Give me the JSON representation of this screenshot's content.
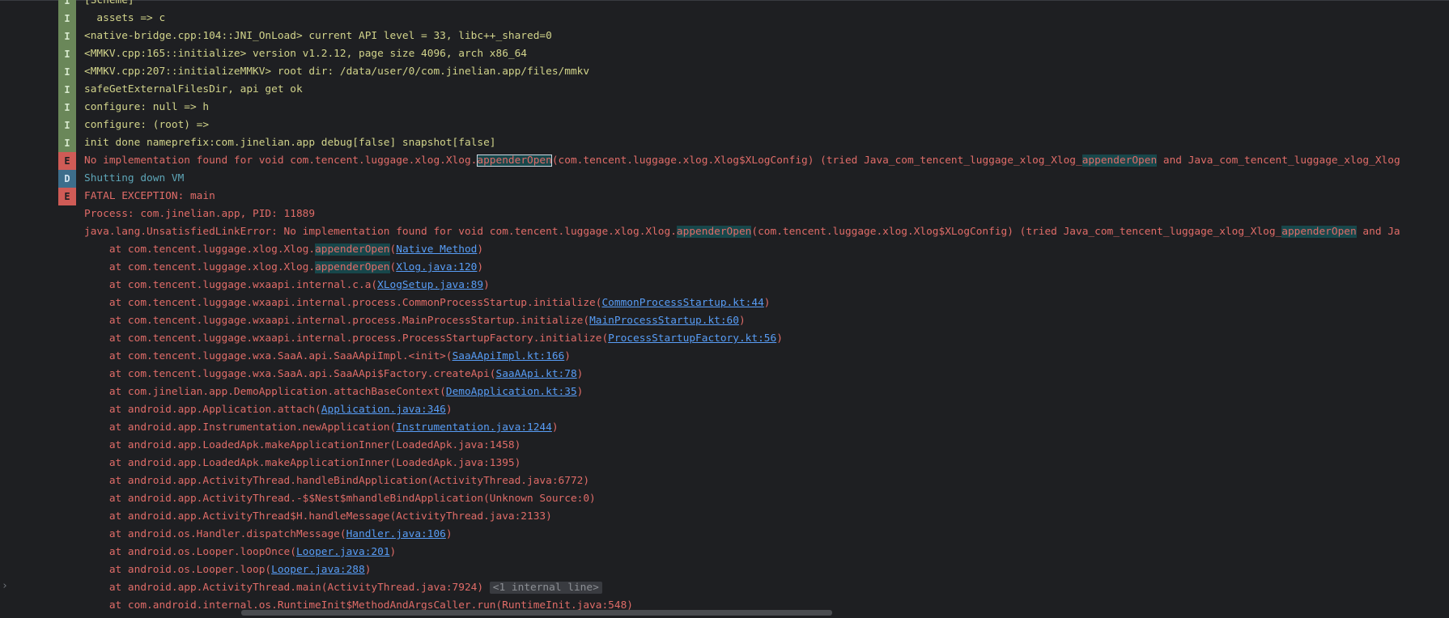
{
  "log": [
    {
      "level": "I",
      "segments": [
        {
          "t": "[Scheme]"
        }
      ]
    },
    {
      "level": "I",
      "segments": [
        {
          "t": "  assets => c"
        }
      ]
    },
    {
      "level": "I",
      "segments": [
        {
          "t": "<native-bridge.cpp:104::JNI_OnLoad> current API level = 33, libc++_shared=0"
        }
      ]
    },
    {
      "level": "I",
      "segments": [
        {
          "t": "<MMKV.cpp:165::initialize> version v1.2.12, page size 4096, arch x86_64"
        }
      ]
    },
    {
      "level": "I",
      "segments": [
        {
          "t": "<MMKV.cpp:207::initializeMMKV> root dir: /data/user/0/com.jinelian.app/files/mmkv"
        }
      ]
    },
    {
      "level": "I",
      "segments": [
        {
          "t": "safeGetExternalFilesDir, api get ok"
        }
      ]
    },
    {
      "level": "I",
      "segments": [
        {
          "t": "configure: null => h"
        }
      ]
    },
    {
      "level": "I",
      "segments": [
        {
          "t": "configure: (root) =>"
        }
      ]
    },
    {
      "level": "I",
      "segments": [
        {
          "t": "init done nameprefix:com.jinelian.app debug[false] snapshot[false]"
        }
      ]
    },
    {
      "level": "E",
      "segments": [
        {
          "t": "No implementation found for void com.tencent.luggage.xlog.Xlog."
        },
        {
          "t": "appenderOpen",
          "hl": "sel"
        },
        {
          "t": "(com.tencent.luggage.xlog.Xlog$XLogConfig) (tried Java_com_tencent_luggage_xlog_Xlog_"
        },
        {
          "t": "appenderOpen",
          "hl": "match"
        },
        {
          "t": " and Java_com_tencent_luggage_xlog_Xlog"
        }
      ]
    },
    {
      "level": "D",
      "segments": [
        {
          "t": "Shutting down VM"
        }
      ]
    },
    {
      "level": "E",
      "segments": [
        {
          "t": "FATAL EXCEPTION: main"
        }
      ]
    },
    {
      "level": "T",
      "segments": [
        {
          "t": "Process: com.jinelian.app, PID: 11889"
        }
      ]
    },
    {
      "level": "T",
      "segments": [
        {
          "t": "java.lang.UnsatisfiedLinkError: No implementation found for void com.tencent.luggage.xlog.Xlog."
        },
        {
          "t": "appenderOpen",
          "hl": "match"
        },
        {
          "t": "(com.tencent.luggage.xlog.Xlog$XLogConfig) (tried Java_com_tencent_luggage_xlog_Xlog_"
        },
        {
          "t": "appenderOpen",
          "hl": "match"
        },
        {
          "t": " and Ja"
        }
      ]
    },
    {
      "level": "T",
      "segments": [
        {
          "t": "    at com.tencent.luggage.xlog.Xlog."
        },
        {
          "t": "appenderOpen",
          "hl": "match"
        },
        {
          "t": "("
        },
        {
          "t": "Native Method",
          "link": true
        },
        {
          "t": ")"
        }
      ]
    },
    {
      "level": "T",
      "segments": [
        {
          "t": "    at com.tencent.luggage.xlog.Xlog."
        },
        {
          "t": "appenderOpen",
          "hl": "match"
        },
        {
          "t": "("
        },
        {
          "t": "Xlog.java:120",
          "link": true
        },
        {
          "t": ")"
        }
      ]
    },
    {
      "level": "T",
      "segments": [
        {
          "t": "    at com.tencent.luggage.wxaapi.internal.c.a("
        },
        {
          "t": "XLogSetup.java:89",
          "link": true
        },
        {
          "t": ")"
        }
      ]
    },
    {
      "level": "T",
      "segments": [
        {
          "t": "    at com.tencent.luggage.wxaapi.internal.process.CommonProcessStartup.initialize("
        },
        {
          "t": "CommonProcessStartup.kt:44",
          "link": true
        },
        {
          "t": ")"
        }
      ]
    },
    {
      "level": "T",
      "segments": [
        {
          "t": "    at com.tencent.luggage.wxaapi.internal.process.MainProcessStartup.initialize("
        },
        {
          "t": "MainProcessStartup.kt:60",
          "link": true
        },
        {
          "t": ")"
        }
      ]
    },
    {
      "level": "T",
      "segments": [
        {
          "t": "    at com.tencent.luggage.wxaapi.internal.process.ProcessStartupFactory.initialize("
        },
        {
          "t": "ProcessStartupFactory.kt:56",
          "link": true
        },
        {
          "t": ")"
        }
      ]
    },
    {
      "level": "T",
      "segments": [
        {
          "t": "    at com.tencent.luggage.wxa.SaaA.api.SaaAApiImpl.<init>("
        },
        {
          "t": "SaaAApiImpl.kt:166",
          "link": true
        },
        {
          "t": ")"
        }
      ]
    },
    {
      "level": "T",
      "segments": [
        {
          "t": "    at com.tencent.luggage.wxa.SaaA.api.SaaAApi$Factory.createApi("
        },
        {
          "t": "SaaAApi.kt:78",
          "link": true
        },
        {
          "t": ")"
        }
      ]
    },
    {
      "level": "T",
      "segments": [
        {
          "t": "    at com.jinelian.app.DemoApplication.attachBaseContext("
        },
        {
          "t": "DemoApplication.kt:35",
          "link": true
        },
        {
          "t": ")"
        }
      ]
    },
    {
      "level": "T",
      "segments": [
        {
          "t": "    at android.app.Application.attach("
        },
        {
          "t": "Application.java:346",
          "link": true
        },
        {
          "t": ")"
        }
      ]
    },
    {
      "level": "T",
      "segments": [
        {
          "t": "    at android.app.Instrumentation.newApplication("
        },
        {
          "t": "Instrumentation.java:1244",
          "link": true
        },
        {
          "t": ")"
        }
      ]
    },
    {
      "level": "T",
      "segments": [
        {
          "t": "    at android.app.LoadedApk.makeApplicationInner(LoadedApk.java:1458)"
        }
      ]
    },
    {
      "level": "T",
      "segments": [
        {
          "t": "    at android.app.LoadedApk.makeApplicationInner(LoadedApk.java:1395)"
        }
      ]
    },
    {
      "level": "T",
      "segments": [
        {
          "t": "    at android.app.ActivityThread.handleBindApplication(ActivityThread.java:6772)"
        }
      ]
    },
    {
      "level": "T",
      "segments": [
        {
          "t": "    at android.app.ActivityThread.-$$Nest$mhandleBindApplication(Unknown Source:0)"
        }
      ]
    },
    {
      "level": "T",
      "segments": [
        {
          "t": "    at android.app.ActivityThread$H.handleMessage(ActivityThread.java:2133)"
        }
      ]
    },
    {
      "level": "T",
      "segments": [
        {
          "t": "    at android.os.Handler.dispatchMessage("
        },
        {
          "t": "Handler.java:106",
          "link": true
        },
        {
          "t": ")"
        }
      ]
    },
    {
      "level": "T",
      "segments": [
        {
          "t": "    at android.os.Looper.loopOnce("
        },
        {
          "t": "Looper.java:201",
          "link": true
        },
        {
          "t": ")"
        }
      ]
    },
    {
      "level": "T",
      "segments": [
        {
          "t": "    at android.os.Looper.loop("
        },
        {
          "t": "Looper.java:288",
          "link": true
        },
        {
          "t": ")"
        }
      ]
    },
    {
      "level": "T",
      "segments": [
        {
          "t": "    at android.app.ActivityThread.main(ActivityThread.java:7924) "
        },
        {
          "t": "<1 internal line>",
          "fold": true
        }
      ]
    },
    {
      "level": "T",
      "segments": [
        {
          "t": "    at com.android.internal.os.RuntimeInit$MethodAndArgsCaller.run(RuntimeInit.java:548)"
        }
      ]
    }
  ],
  "gutter_arrow": "›"
}
